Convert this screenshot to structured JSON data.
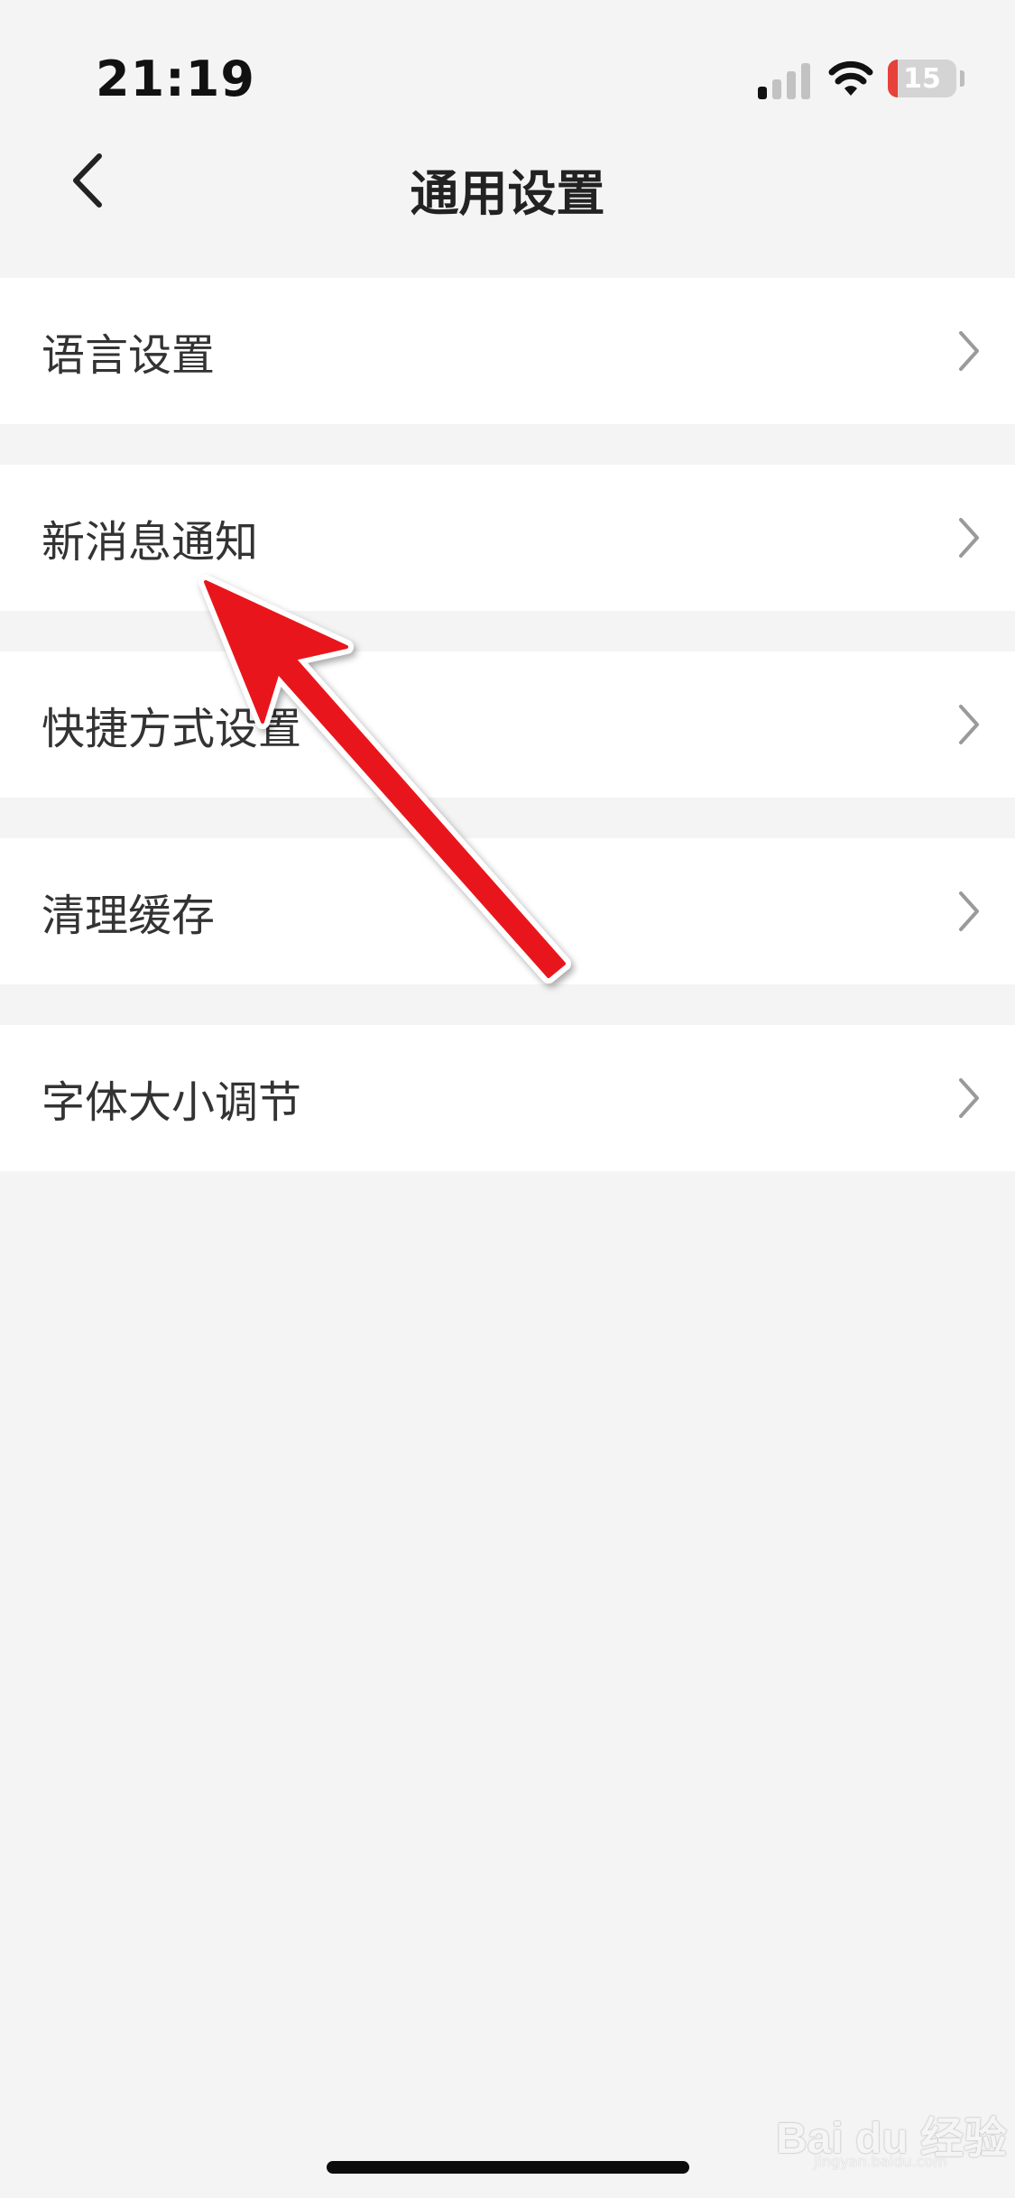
{
  "status_bar": {
    "time": "21:19",
    "battery": "15",
    "battery_level": 0.15,
    "signal_bars_active": 1,
    "signal_bars_total": 4,
    "icons": [
      "signal-icon",
      "wifi-icon",
      "battery-icon"
    ]
  },
  "nav": {
    "title": "通用设置",
    "back_icon": "chevron-left-icon"
  },
  "settings": {
    "items": [
      {
        "label": "语言设置"
      },
      {
        "label": "新消息通知"
      },
      {
        "label": "快捷方式设置"
      },
      {
        "label": "清理缓存"
      },
      {
        "label": "字体大小调节"
      }
    ],
    "chevron_icon": "chevron-right-icon"
  },
  "annotation": {
    "type": "red-arrow",
    "color": "#e8141a",
    "points_to": "新消息通知"
  },
  "watermark": {
    "brand": "Bai du 经验",
    "url": "jingyan.baidu.com"
  },
  "colors": {
    "background": "#f4f4f4",
    "card": "#ffffff",
    "text": "#333333",
    "chevron": "#9a9a9a",
    "battery_low": "#e8403a"
  }
}
